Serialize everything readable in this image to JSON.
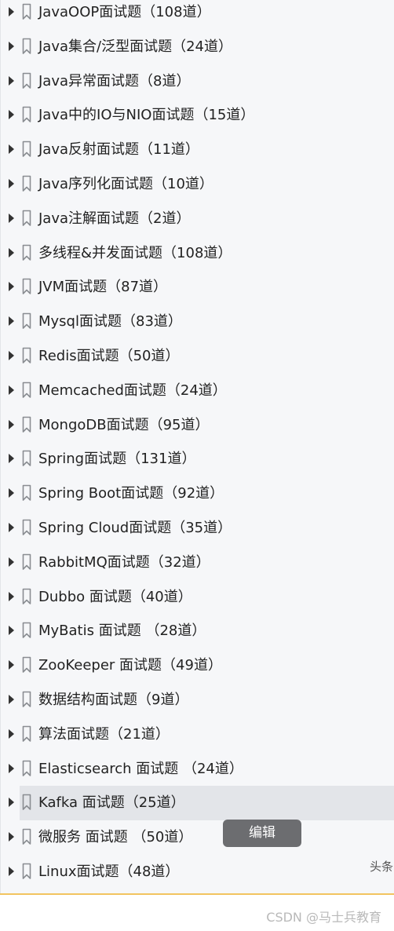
{
  "outline": {
    "items": [
      {
        "label": "JavaOOP面试题（108道）"
      },
      {
        "label": "Java集合/泛型面试题（24道）"
      },
      {
        "label": "Java异常面试题（8道）"
      },
      {
        "label": "Java中的IO与NIO面试题（15道）"
      },
      {
        "label": "Java反射面试题（11道）"
      },
      {
        "label": "Java序列化面试题（10道）"
      },
      {
        "label": "Java注解面试题（2道）"
      },
      {
        "label": "多线程&并发面试题（108道）"
      },
      {
        "label": "JVM面试题（87道）"
      },
      {
        "label": "Mysql面试题（83道）"
      },
      {
        "label": "Redis面试题（50道）"
      },
      {
        "label": "Memcached面试题（24道）"
      },
      {
        "label": "MongoDB面试题（95道）"
      },
      {
        "label": "Spring面试题（131道）"
      },
      {
        "label": "Spring Boot面试题（92道）"
      },
      {
        "label": "Spring Cloud面试题（35道）"
      },
      {
        "label": "RabbitMQ面试题（32道）"
      },
      {
        "label": "Dubbo 面试题（40道）"
      },
      {
        "label": "MyBatis 面试题 （28道）"
      },
      {
        "label": "ZooKeeper 面试题（49道）"
      },
      {
        "label": "数据结构面试题（9道）"
      },
      {
        "label": "算法面试题（21道）"
      },
      {
        "label": "Elasticsearch 面试题 （24道）"
      },
      {
        "label": "Kafka 面试题（25道）"
      },
      {
        "label": "微服务 面试题 （50道）"
      },
      {
        "label": "Linux面试题（48道）"
      }
    ],
    "selected_index": 23
  },
  "edit_button": {
    "label": "编辑"
  },
  "cut_text": "头条",
  "watermark": "CSDN @马士兵教育",
  "colors": {
    "panel_bg": "#f6f7f9",
    "selected_bg": "#e3e5e9",
    "edit_button_bg": "#6c6d70",
    "divider": "#f2c45f"
  },
  "icons": {
    "expand": "caret-right-icon",
    "item": "bookmark-icon"
  }
}
